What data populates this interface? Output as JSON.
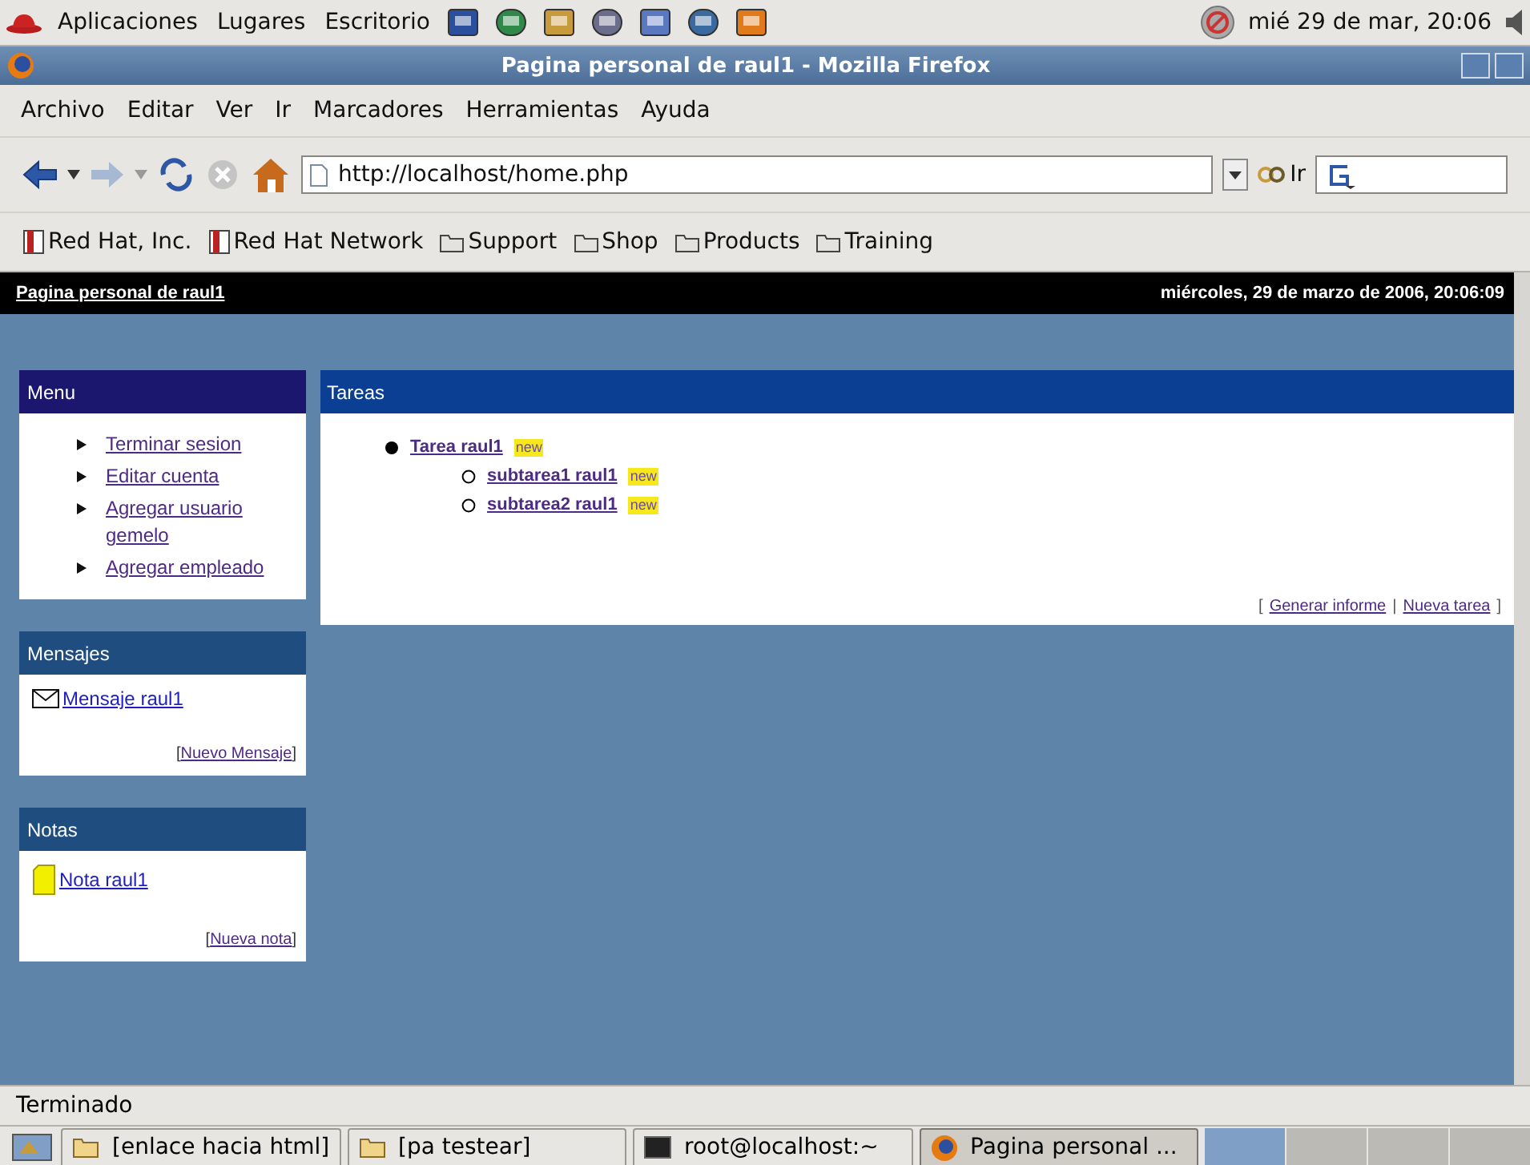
{
  "top_panel": {
    "menus": [
      "Aplicaciones",
      "Lugares",
      "Escritorio"
    ],
    "clock": "mié 29 de mar, 20:06"
  },
  "window": {
    "title": "Pagina personal de raul1 - Mozilla Firefox"
  },
  "menu_bar": [
    "Archivo",
    "Editar",
    "Ver",
    "Ir",
    "Marcadores",
    "Herramientas",
    "Ayuda"
  ],
  "toolbar": {
    "address": "http://localhost/home.php",
    "go_label": "Ir"
  },
  "bookmarks": [
    {
      "label": "Red Hat, Inc.",
      "kind": "page"
    },
    {
      "label": "Red Hat Network",
      "kind": "page"
    },
    {
      "label": "Support",
      "kind": "folder"
    },
    {
      "label": "Shop",
      "kind": "folder"
    },
    {
      "label": "Products",
      "kind": "folder"
    },
    {
      "label": "Training",
      "kind": "folder"
    }
  ],
  "page": {
    "header_title": "Pagina personal de raul1",
    "header_date": "miércoles, 29 de marzo de 2006, 20:06:09",
    "menu": {
      "title": "Menu",
      "items": [
        "Terminar sesion",
        "Editar cuenta",
        "Agregar usuario gemelo",
        "Agregar empleado"
      ]
    },
    "messages": {
      "title": "Mensajes",
      "items": [
        "Mensaje raul1"
      ],
      "open": "[",
      "action": "Nuevo Mensaje",
      "close": "]"
    },
    "notes": {
      "title": "Notas",
      "items": [
        "Nota raul1"
      ],
      "open": "[",
      "action": "Nueva nota",
      "close": "]"
    },
    "tasks": {
      "title": "Tareas",
      "items": [
        {
          "label": "Tarea raul1",
          "badge": "new",
          "children": [
            {
              "label": "subtarea1 raul1",
              "badge": "new"
            },
            {
              "label": "subtarea2 raul1",
              "badge": "new"
            }
          ]
        }
      ],
      "open": "[",
      "actions": [
        "Generar informe",
        "Nueva tarea"
      ],
      "separator": "|",
      "close": "]"
    }
  },
  "status_bar": "Terminado",
  "taskbar": [
    {
      "label": "[enlace hacia html]",
      "kind": "folder",
      "selected": false
    },
    {
      "label": "[pa testear]",
      "kind": "folder",
      "selected": false
    },
    {
      "label": "root@localhost:~",
      "kind": "terminal",
      "selected": false
    },
    {
      "label": "Pagina personal ...",
      "kind": "browser",
      "selected": true
    }
  ]
}
